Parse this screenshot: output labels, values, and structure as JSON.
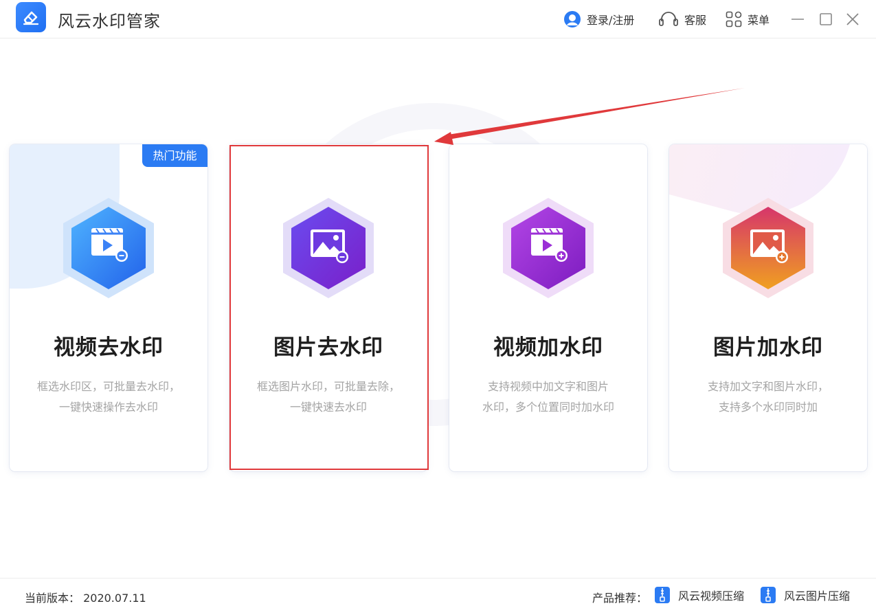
{
  "app": {
    "title": "风云水印管家"
  },
  "header": {
    "login_label": "登录/注册",
    "service_label": "客服",
    "menu_label": "菜单"
  },
  "cards": [
    {
      "title": "视频去水印",
      "desc_line1": "框选水印区，可批量去水印，",
      "desc_line2": "一键快速操作去水印",
      "badge": "热门功能",
      "icon": "video-remove-icon"
    },
    {
      "title": "图片去水印",
      "desc_line1": "框选图片水印，可批量去除，",
      "desc_line2": "一键快速去水印",
      "icon": "image-remove-icon"
    },
    {
      "title": "视频加水印",
      "desc_line1": "支持视频中加文字和图片",
      "desc_line2": "水印，多个位置同时加水印",
      "icon": "video-add-icon"
    },
    {
      "title": "图片加水印",
      "desc_line1": "支持加文字和图片水印，",
      "desc_line2": "支持多个水印同时加",
      "icon": "image-add-icon"
    }
  ],
  "footer": {
    "version": "当前版本：  2020.07.11",
    "recommend_label": "产品推荐：",
    "recommend_items": [
      "风云视频压缩",
      "风云图片压缩"
    ]
  },
  "colors": {
    "accent": "#2b7bf3",
    "highlight": "#e0393b",
    "card1": "#2f86f5",
    "card2": "#6a2fd6",
    "card3": "#9b2fd6",
    "card4": "#e0583a"
  }
}
